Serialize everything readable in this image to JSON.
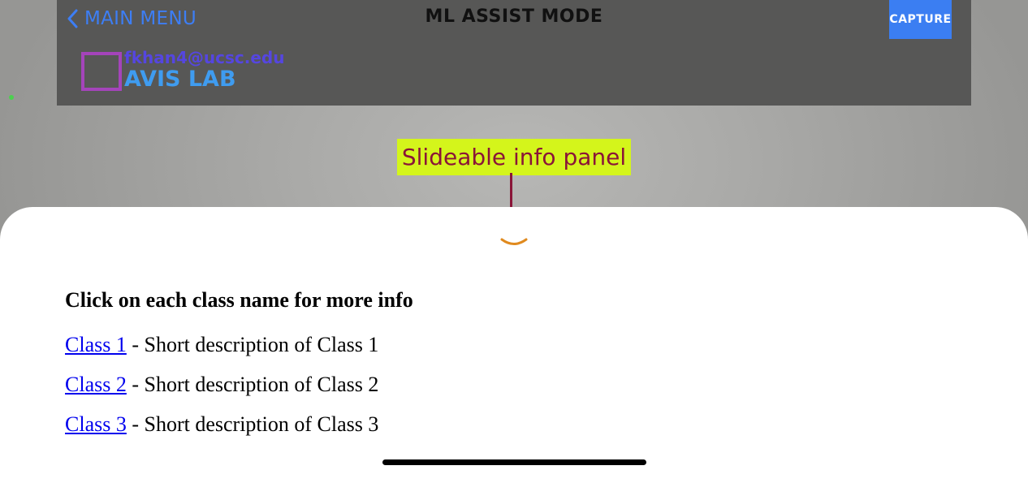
{
  "header": {
    "back_label": "MAIN MENU",
    "title": "ML ASSIST MODE",
    "capture_label": "CAPTURE",
    "user_email": "fkhan4@ucsc.edu",
    "lab_name": "AVIS LAB"
  },
  "annotation": {
    "label": "Slideable info panel"
  },
  "panel": {
    "heading": "Click on each class name for more info",
    "classes": [
      {
        "name": "Class 1",
        "description": " - Short description of Class 1"
      },
      {
        "name": "Class 2",
        "description": " - Short description of Class 2"
      },
      {
        "name": "Class 3",
        "description": " - Short description of Class 3"
      }
    ]
  },
  "colors": {
    "accent_blue": "#3d7ef5",
    "capture_button": "#3b7ef2",
    "logo_purple": "#a444ba",
    "annotation_bg": "#d4f51b",
    "annotation_text": "#8a1538",
    "chevron": "#e08a1e",
    "link": "#0000ee"
  },
  "icons": {
    "back": "chevron-left-icon",
    "panel_toggle": "chevron-down-icon",
    "logo": "square-logo-icon"
  }
}
